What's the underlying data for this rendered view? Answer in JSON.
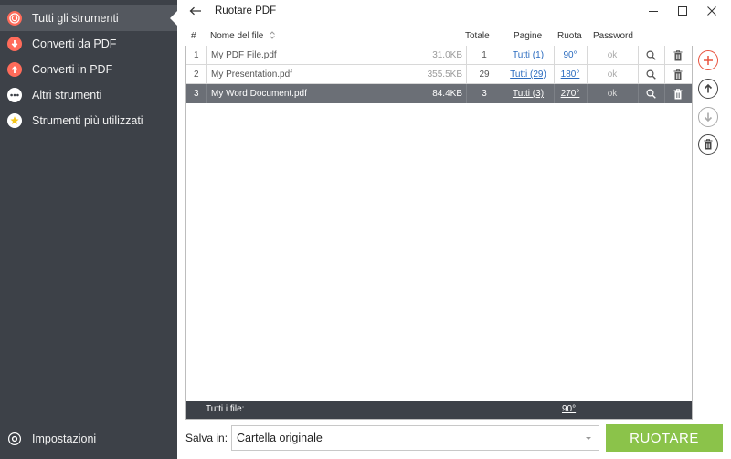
{
  "sidebar": {
    "items": [
      {
        "label": "Tutti gli strumenti",
        "icon": "all-tools-icon",
        "color": "#ff6b5a"
      },
      {
        "label": "Converti da PDF",
        "icon": "convert-from-pdf-icon",
        "color": "#ff6b5a"
      },
      {
        "label": "Converti in PDF",
        "icon": "convert-to-pdf-icon",
        "color": "#ff6b5a"
      },
      {
        "label": "Altri strumenti",
        "icon": "more-tools-icon",
        "color": "#ffffff"
      },
      {
        "label": "Strumenti più utilizzati",
        "icon": "star-icon",
        "color": "#f5d33b"
      }
    ],
    "settings_label": "Impostazioni"
  },
  "window": {
    "title": "Ruotare PDF"
  },
  "table": {
    "headers": {
      "num": "#",
      "name": "Nome del file",
      "total": "Totale",
      "pages": "Pagine",
      "rotate": "Ruota",
      "password": "Password"
    },
    "rows": [
      {
        "num": "1",
        "name": "My PDF File.pdf",
        "size": "31.0KB",
        "total": "1",
        "pages": "Tutti (1)",
        "rotate": "90°",
        "password": "ok"
      },
      {
        "num": "2",
        "name": "My Presentation.pdf",
        "size": "355.5KB",
        "total": "29",
        "pages": "Tutti (29)",
        "rotate": "180°",
        "password": "ok"
      },
      {
        "num": "3",
        "name": "My Word Document.pdf",
        "size": "84.4KB",
        "total": "3",
        "pages": "Tutti (3)",
        "rotate": "270°",
        "password": "ok"
      }
    ],
    "footer": {
      "label": "Tutti i file:",
      "rotate": "90°"
    }
  },
  "bottom": {
    "save_label": "Salva in:",
    "save_value": "Cartella originale",
    "run_label": "RUOTARE"
  },
  "colors": {
    "accent": "#8bc34a",
    "sidebar_bg": "#3d4148",
    "add": "#e8533f"
  }
}
